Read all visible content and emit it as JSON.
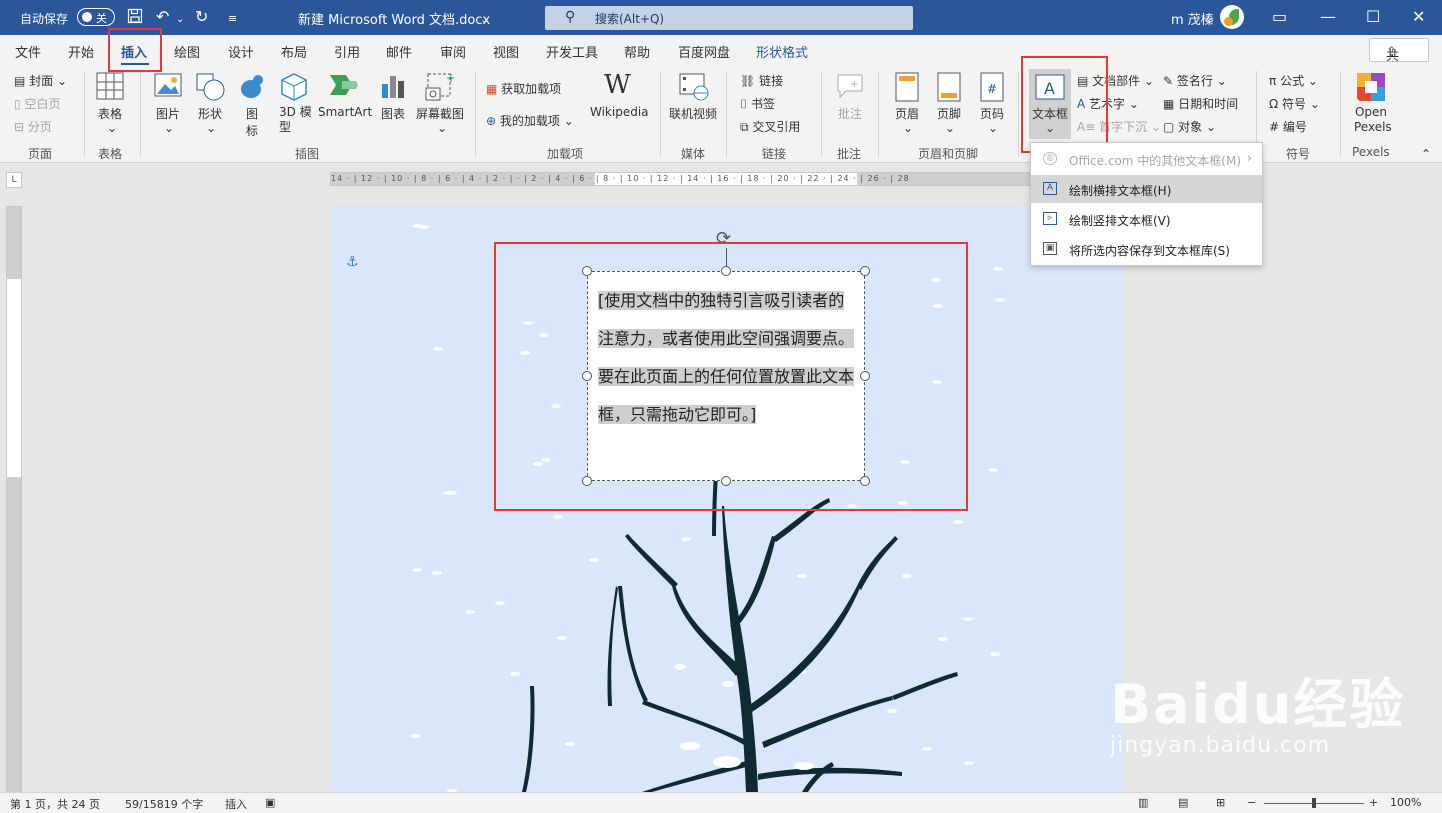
{
  "titlebar": {
    "autosave_label": "自动保存",
    "toggle_state": "关",
    "doc_title": "新建 Microsoft Word 文档.docx",
    "search_placeholder": "搜索(Alt+Q)",
    "user_name": "m 茂榛"
  },
  "tabs": [
    "文件",
    "开始",
    "插入",
    "绘图",
    "设计",
    "布局",
    "引用",
    "邮件",
    "审阅",
    "视图",
    "开发工具",
    "帮助",
    "百度网盘",
    "形状格式"
  ],
  "active_tab": "插入",
  "share_label": "共享",
  "ribbon": {
    "pages": {
      "cover": "封面",
      "blank": "空白页",
      "break": "分页",
      "group": "页面"
    },
    "table": {
      "label": "表格",
      "group": "表格"
    },
    "illustrations": {
      "picture": "图片",
      "shape": "形状",
      "icon": "图标",
      "model3d": "3D 模型",
      "smartart": "SmartArt",
      "chart": "图表",
      "screenshot": "屏幕截图",
      "group": "插图"
    },
    "addins": {
      "get": "获取加载项",
      "mine": "我的加载项",
      "wiki": "Wikipedia",
      "group": "加载项"
    },
    "media": {
      "online_video": "联机视频",
      "group": "媒体"
    },
    "links": {
      "link": "链接",
      "bookmark": "书签",
      "crossref": "交叉引用",
      "group": "链接"
    },
    "comments": {
      "comment": "批注",
      "group": "批注"
    },
    "header_footer": {
      "header": "页眉",
      "footer": "页脚",
      "page_number": "页码",
      "group": "页眉和页脚"
    },
    "text": {
      "textbox": "文本框",
      "quick_parts": "文档部件",
      "wordart": "艺术字",
      "dropcap": "首字下沉",
      "signature": "签名行",
      "datetime": "日期和时间",
      "object": "对象"
    },
    "symbols": {
      "equation": "公式",
      "symbol": "符号",
      "number": "编号",
      "group": "符号"
    },
    "pexels": {
      "label": "Open Pexels",
      "group": "Pexels"
    }
  },
  "ruler_numbers": "14 · | 12 · | 10 · | 8 · | 6 · | 4 · | 2 · |   · | 2 · | 4 · | 6 · | 8 · | 10 · | 12 · | 14 · | 16 · | 18 · | 20 · | 22 · | 24 · | 26 · | 28",
  "textbox_menu": {
    "items": [
      {
        "label": "Office.com 中的其他文本框(M)",
        "enabled": false,
        "icon": "globe-icon"
      },
      {
        "label": "绘制横排文本框(H)",
        "enabled": true,
        "icon": "horizontal-textbox-icon"
      },
      {
        "label": "绘制竖排文本框(V)",
        "enabled": true,
        "icon": "vertical-textbox-icon"
      },
      {
        "label": "将所选内容保存到文本框库(S)",
        "enabled": true,
        "icon": "save-icon"
      }
    ]
  },
  "textbox_content": "[使用文档中的独特引言吸引读者的注意力，或者使用此空间强调要点。要在此页面上的任何位置放置此文本框，只需拖动它即可。]",
  "status": {
    "page": "第 1 页，共 24 页",
    "words": "59/15819 个字",
    "mode": "插入",
    "zoom": "100%"
  },
  "watermark": {
    "brand": "Baidu经验",
    "url": "jingyan.baidu.com"
  },
  "colors": {
    "title_bar": "#2b579a",
    "page_bg": "#d9e6fb",
    "highlight": "#e03a3a",
    "tree": "#0f2a33"
  }
}
